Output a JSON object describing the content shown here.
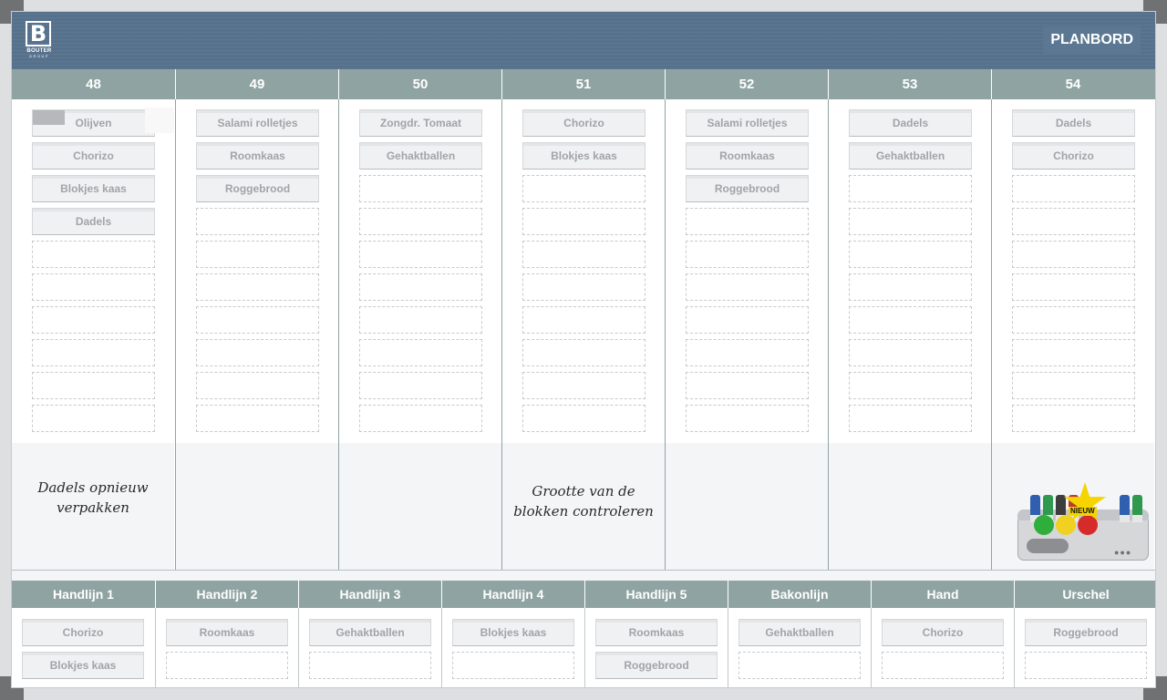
{
  "brand": {
    "logo_letter": "B",
    "logo_name": "BOUTER",
    "logo_sub": "GROUP"
  },
  "board_title": "PLANBORD",
  "weeks": [
    {
      "number": "48",
      "cards": [
        "Olijven",
        "Chorizo",
        "Blokjes kaas",
        "Dadels"
      ],
      "note": "Dadels opnieuw verpakken"
    },
    {
      "number": "49",
      "cards": [
        "Salami rolletjes",
        "Roomkaas",
        "Roggebrood"
      ]
    },
    {
      "number": "50",
      "cards": [
        "Zongdr. Tomaat",
        "Gehaktballen"
      ]
    },
    {
      "number": "51",
      "cards": [
        "Chorizo",
        "Blokjes kaas"
      ],
      "note": "Grootte van de blokken controleren"
    },
    {
      "number": "52",
      "cards": [
        "Salami rolletjes",
        "Roomkaas",
        "Roggebrood"
      ]
    },
    {
      "number": "53",
      "cards": [
        "Dadels",
        "Gehaktballen"
      ]
    },
    {
      "number": "54",
      "cards": [
        "Dadels",
        "Chorizo"
      ]
    }
  ],
  "production_lines": [
    {
      "name": "Handlijn 1",
      "cards": [
        "Chorizo",
        "Blokjes kaas"
      ]
    },
    {
      "name": "Handlijn 2",
      "cards": [
        "Roomkaas"
      ]
    },
    {
      "name": "Handlijn 3",
      "cards": [
        "Gehaktballen"
      ]
    },
    {
      "name": "Handlijn 4",
      "cards": [
        "Blokjes kaas"
      ]
    },
    {
      "name": "Handlijn 5",
      "cards": [
        "Roomkaas",
        "Roggebrood"
      ]
    },
    {
      "name": "Bakonlijn",
      "cards": [
        "Gehaktballen"
      ]
    },
    {
      "name": "Hand",
      "cards": [
        "Chorizo"
      ]
    },
    {
      "name": "Urschel",
      "cards": [
        "Roggebrood"
      ]
    }
  ],
  "tray": {
    "badge": "NIEUW",
    "marker_colors": [
      "#2f5fae",
      "#2f9a4f",
      "#3d3d3d",
      "#c0392b",
      "#2f5fae",
      "#2f9a4f"
    ],
    "magnet_colors": [
      "#2fae3b",
      "#f0d020",
      "#d62b2b"
    ]
  },
  "colors": {
    "header": "#56718c",
    "column_header": "#8fa4a2",
    "card_text": "#a1a4a8"
  }
}
